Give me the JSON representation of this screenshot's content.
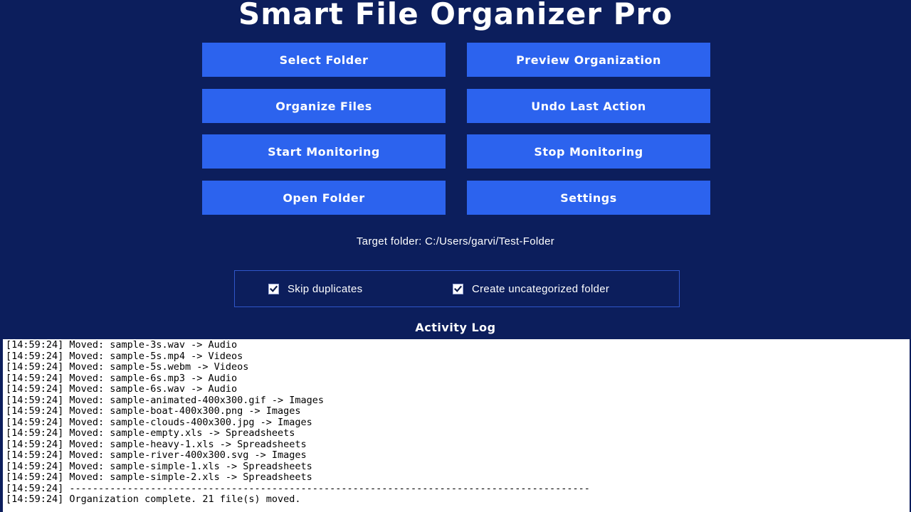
{
  "app": {
    "title": "Smart File Organizer Pro"
  },
  "buttons": {
    "select_folder": "Select Folder",
    "preview_organization": "Preview Organization",
    "organize_files": "Organize Files",
    "undo_last_action": "Undo Last Action",
    "start_monitoring": "Start Monitoring",
    "stop_monitoring": "Stop Monitoring",
    "open_folder": "Open Folder",
    "settings": "Settings"
  },
  "target_folder": {
    "text": "Target folder: C:/Users/garvi/Test-Folder"
  },
  "options": {
    "skip_duplicates": {
      "label": "Skip duplicates",
      "checked": true
    },
    "create_uncategorized": {
      "label": "Create uncategorized folder",
      "checked": true
    }
  },
  "log": {
    "title": "Activity Log",
    "lines": [
      "[14:59:24] Moved: sample-3s.wav -> Audio",
      "[14:59:24] Moved: sample-5s.mp4 -> Videos",
      "[14:59:24] Moved: sample-5s.webm -> Videos",
      "[14:59:24] Moved: sample-6s.mp3 -> Audio",
      "[14:59:24] Moved: sample-6s.wav -> Audio",
      "[14:59:24] Moved: sample-animated-400x300.gif -> Images",
      "[14:59:24] Moved: sample-boat-400x300.png -> Images",
      "[14:59:24] Moved: sample-clouds-400x300.jpg -> Images",
      "[14:59:24] Moved: sample-empty.xls -> Spreadsheets",
      "[14:59:24] Moved: sample-heavy-1.xls -> Spreadsheets",
      "[14:59:24] Moved: sample-river-400x300.svg -> Images",
      "[14:59:24] Moved: sample-simple-1.xls -> Spreadsheets",
      "[14:59:24] Moved: sample-simple-2.xls -> Spreadsheets",
      "[14:59:24] ------------------------------------------------------------------------------------------",
      "[14:59:24] Organization complete. 21 file(s) moved."
    ]
  },
  "colors": {
    "background": "#0c1e5c",
    "button": "#2c63ee",
    "text": "#ffffff",
    "log_background": "#ffffff"
  }
}
